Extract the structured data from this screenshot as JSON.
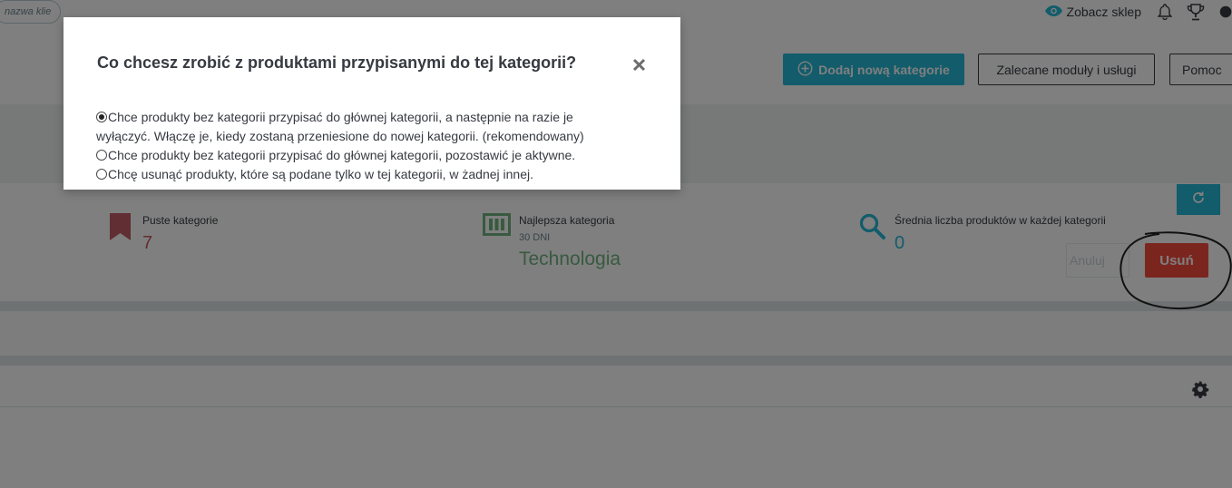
{
  "topbar": {
    "customer_pill": "nazwa klie",
    "view_shop_label": "Zobacz sklep",
    "icons": [
      "eye-icon",
      "bell-icon",
      "trophy-icon",
      "user-icon"
    ]
  },
  "header": {
    "add_category_label": "Dodaj nową kategorie",
    "recommended_label": "Zalecane moduły i usługi",
    "help_label": "Pomoc"
  },
  "kpis": {
    "empty": {
      "label": "Puste kategorie",
      "value": "7"
    },
    "best": {
      "label": "Najlepsza kategoria",
      "period": "30 DNI",
      "value": "Technologia"
    },
    "avg": {
      "label": "Średnia liczba produktów w każdej kategorii",
      "value": "0"
    }
  },
  "actions": {
    "cancel_label": "Anuluj",
    "delete_label": "Usuń"
  },
  "modal": {
    "title": "Co chcesz zrobić z produktami przypisanymi do tej kategorii?",
    "options": [
      {
        "line1": "Chce produkty bez kategorii przypisać do głównej kategorii, a następnie na razie je",
        "line2": "wyłączyć. Włączę je, kiedy zostaną przeniesione do nowej kategorii. (rekomendowany)",
        "selected": true
      },
      {
        "line1": "Chce produkty bez kategorii przypisać do głównej kategorii, pozostawić je aktywne.",
        "selected": false
      },
      {
        "line1": "Chcę usunąć produkty, które są podane tylko w tej kategorii, w żadnej innej.",
        "selected": false
      }
    ]
  },
  "colors": {
    "accent": "#25b9d7",
    "danger": "#f54c3e",
    "empty_kpi": "#c05c67",
    "best_kpi": "#70b580",
    "avg_kpi": "#25b9d7"
  }
}
